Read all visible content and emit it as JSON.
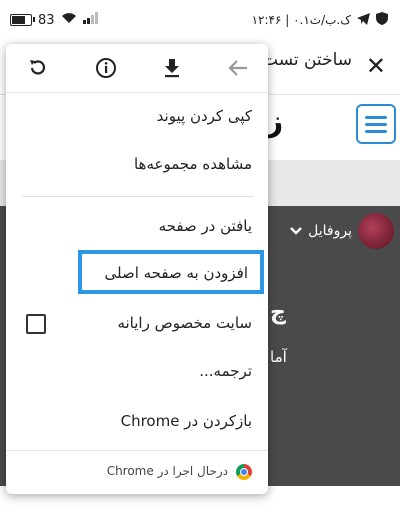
{
  "status_bar": {
    "battery": "83",
    "battery_fraction": 0.83,
    "time": "۱۲:۴۶ | ۰.۱ک.ب/ث"
  },
  "page": {
    "title": "ساختن تست",
    "profile_label": "پروفایل",
    "logo_partial": "ز",
    "hero_text_1": "چ",
    "hero_text_2": "آما"
  },
  "menu": {
    "toolbar_icons": [
      "refresh-icon",
      "info-icon",
      "download-icon",
      "back-arrow-icon"
    ],
    "items": [
      {
        "label": "کپی کردن پیوند"
      },
      {
        "label": "مشاهده مجموعه‌ها"
      },
      {
        "label": "یافتن در صفحه"
      },
      {
        "label": "افزودن به صفحه اصلی"
      },
      {
        "label": "سایت مخصوص رایانه"
      },
      {
        "label": "ترجمه..."
      },
      {
        "label": "بازکردن در Chrome"
      }
    ],
    "footer_text": "درحال اجرا در Chrome",
    "highlight_color": "#2b97e6"
  }
}
